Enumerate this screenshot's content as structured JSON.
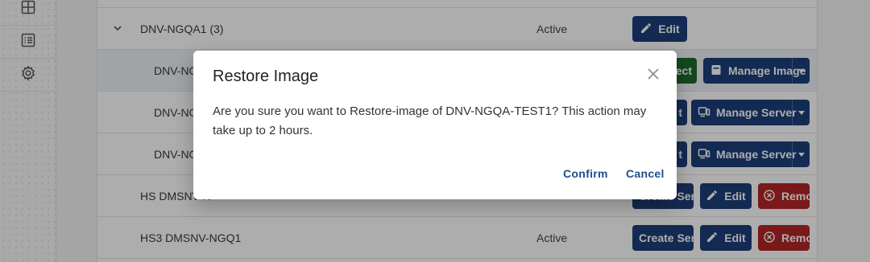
{
  "sidebar": {
    "items": [
      {
        "icon": "grid-icon"
      },
      {
        "icon": "list-icon"
      },
      {
        "icon": "gear-icon"
      }
    ]
  },
  "table": {
    "group_row": {
      "name": "DNV-NGQA1 (3)",
      "status": "Active",
      "edit_label": "Edit"
    },
    "child_rows": [
      {
        "name": "DNV-NG",
        "connect_label": "Connect",
        "manage_label": "Manage Image"
      },
      {
        "name": "DNV-NG",
        "partial_label": "t",
        "manage_label": "Manage Server"
      },
      {
        "name": "DNV-NG",
        "partial_label": "t",
        "manage_label": "Manage Server"
      }
    ],
    "rows": [
      {
        "name": "HS DMSNV-N",
        "status": "",
        "create_label": "Create Server",
        "edit_label": "Edit",
        "remove_label": "Remove"
      },
      {
        "name": "HS3 DMSNV-NGQ1",
        "status": "Active",
        "create_label": "Create Server",
        "edit_label": "Edit",
        "remove_label": "Remove"
      }
    ]
  },
  "dialog": {
    "title": "Restore Image",
    "message": "Are you sure you want to Restore-image of DNV-NGQA-TEST1? This action may take up to 2 hours.",
    "confirm_label": "Confirm",
    "cancel_label": "Cancel"
  },
  "colors": {
    "primary": "#1c3f7a",
    "success": "#1d6b2e",
    "danger": "#b32626",
    "link": "#1f4e8c"
  }
}
